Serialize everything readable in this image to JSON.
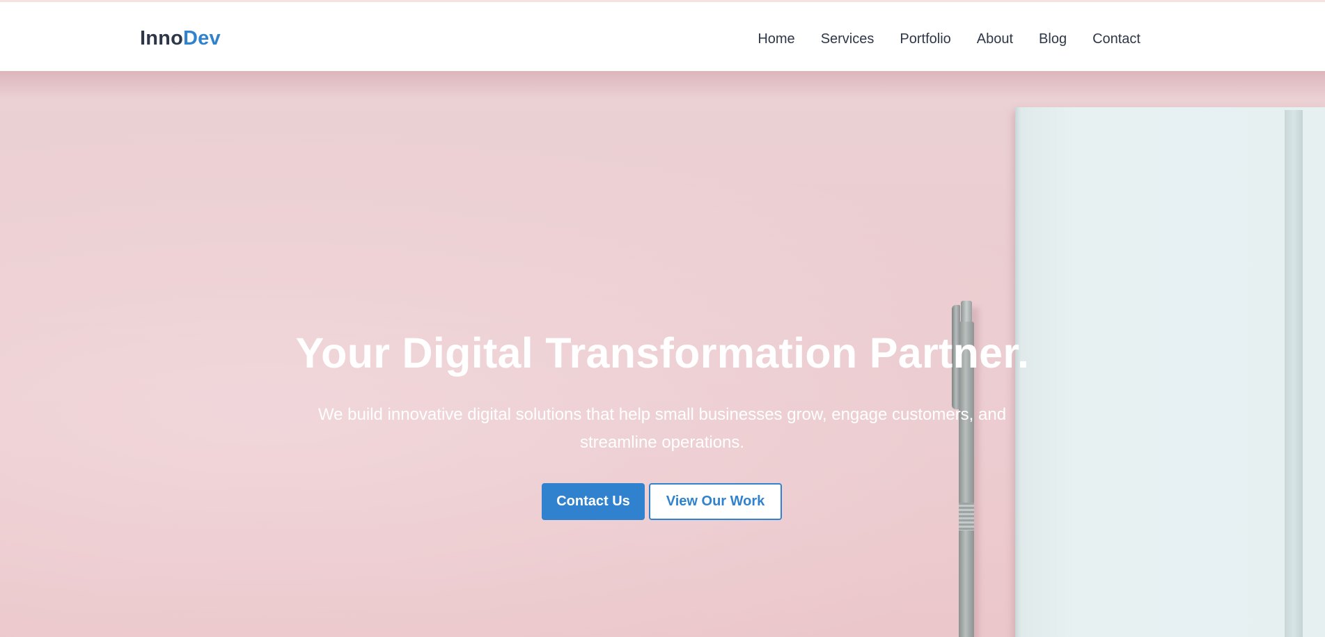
{
  "brand": {
    "logo_part1": "Inno",
    "logo_part2": "Dev",
    "accent_color": "#3182ce",
    "text_color": "#2d3748"
  },
  "nav": {
    "items": [
      {
        "label": "Home"
      },
      {
        "label": "Services"
      },
      {
        "label": "Portfolio"
      },
      {
        "label": "About"
      },
      {
        "label": "Blog"
      },
      {
        "label": "Contact"
      }
    ]
  },
  "hero": {
    "title": "Your Digital Transformation Partner.",
    "subtitle": "We build innovative digital solutions that help small businesses grow, engage customers, and streamline operations.",
    "primary_button": "Contact Us",
    "secondary_button": "View Our Work",
    "background_color": "#ebcbcf"
  }
}
